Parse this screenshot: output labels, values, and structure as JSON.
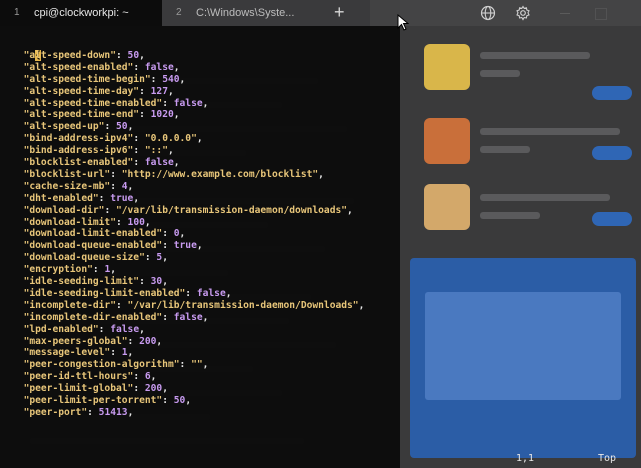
{
  "tabs": [
    {
      "number": "1",
      "title": "cpi@clockworkpi: ~"
    },
    {
      "number": "2",
      "title": "C:\\Windows\\Syste..."
    }
  ],
  "new_tab_label": "+",
  "json_lines": [
    {
      "key": "\"alt-speed-down\"",
      "value": "50",
      "vtype": "num"
    },
    {
      "key": "\"alt-speed-enabled\"",
      "value": "false",
      "vtype": "bool"
    },
    {
      "key": "\"alt-speed-time-begin\"",
      "value": "540",
      "vtype": "num"
    },
    {
      "key": "\"alt-speed-time-day\"",
      "value": "127",
      "vtype": "num"
    },
    {
      "key": "\"alt-speed-time-enabled\"",
      "value": "false",
      "vtype": "bool"
    },
    {
      "key": "\"alt-speed-time-end\"",
      "value": "1020",
      "vtype": "num"
    },
    {
      "key": "\"alt-speed-up\"",
      "value": "50",
      "vtype": "num"
    },
    {
      "key": "\"bind-address-ipv4\"",
      "value": "\"0.0.0.0\"",
      "vtype": "str"
    },
    {
      "key": "\"bind-address-ipv6\"",
      "value": "\"::\"",
      "vtype": "str"
    },
    {
      "key": "\"blocklist-enabled\"",
      "value": "false",
      "vtype": "bool"
    },
    {
      "key": "\"blocklist-url\"",
      "value": "\"http://www.example.com/blocklist\"",
      "vtype": "str"
    },
    {
      "key": "\"cache-size-mb\"",
      "value": "4",
      "vtype": "num"
    },
    {
      "key": "\"dht-enabled\"",
      "value": "true",
      "vtype": "bool"
    },
    {
      "key": "\"download-dir\"",
      "value": "\"/var/lib/transmission-daemon/downloads\"",
      "vtype": "str"
    },
    {
      "key": "\"download-limit\"",
      "value": "100",
      "vtype": "num"
    },
    {
      "key": "\"download-limit-enabled\"",
      "value": "0",
      "vtype": "num"
    },
    {
      "key": "\"download-queue-enabled\"",
      "value": "true",
      "vtype": "bool"
    },
    {
      "key": "\"download-queue-size\"",
      "value": "5",
      "vtype": "num"
    },
    {
      "key": "\"encryption\"",
      "value": "1",
      "vtype": "num"
    },
    {
      "key": "\"idle-seeding-limit\"",
      "value": "30",
      "vtype": "num"
    },
    {
      "key": "\"idle-seeding-limit-enabled\"",
      "value": "false",
      "vtype": "bool"
    },
    {
      "key": "\"incomplete-dir\"",
      "value": "\"/var/lib/transmission-daemon/Downloads\"",
      "vtype": "str"
    },
    {
      "key": "\"incomplete-dir-enabled\"",
      "value": "false",
      "vtype": "bool"
    },
    {
      "key": "\"lpd-enabled\"",
      "value": "false",
      "vtype": "bool"
    },
    {
      "key": "\"max-peers-global\"",
      "value": "200",
      "vtype": "num"
    },
    {
      "key": "\"message-level\"",
      "value": "1",
      "vtype": "num"
    },
    {
      "key": "\"peer-congestion-algorithm\"",
      "value": "\"\"",
      "vtype": "str"
    },
    {
      "key": "\"peer-id-ttl-hours\"",
      "value": "6",
      "vtype": "num"
    },
    {
      "key": "\"peer-limit-global\"",
      "value": "200",
      "vtype": "num"
    },
    {
      "key": "\"peer-limit-per-torrent\"",
      "value": "50",
      "vtype": "num"
    },
    {
      "key": "\"peer-port\"",
      "value": "51413",
      "vtype": "num"
    }
  ],
  "open_brace": "{",
  "status": {
    "position": "1,1",
    "scroll": "Top"
  },
  "icons": {
    "globe": "globe-icon",
    "settings": "gear-icon"
  },
  "colors": {
    "key": "#e8c67a",
    "number": "#c89bf0",
    "cursor": "#e8b84a"
  }
}
